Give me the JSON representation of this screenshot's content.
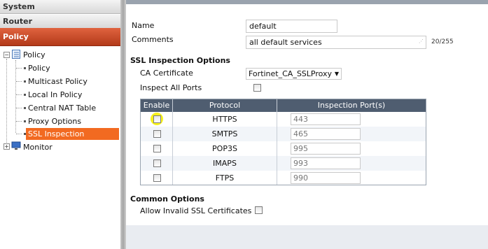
{
  "nav": {
    "system": "System",
    "router": "Router",
    "policy": "Policy",
    "tree": {
      "policy_folder": "Policy",
      "items": [
        "Policy",
        "Multicast Policy",
        "Local In Policy",
        "Central NAT Table",
        "Proxy Options",
        "SSL Inspection"
      ],
      "selected_index": 5,
      "monitor": "Monitor"
    }
  },
  "form": {
    "name_label": "Name",
    "name_value": "default",
    "comments_label": "Comments",
    "comments_value": "all default services",
    "comments_counter": "20/255",
    "ssl_heading": "SSL Inspection Options",
    "ca_label": "CA Certificate",
    "ca_value": "Fortinet_CA_SSLProxy",
    "inspect_all_label": "Inspect All Ports",
    "inspect_all_checked": false,
    "common_heading": "Common Options",
    "allow_invalid_label": "Allow Invalid SSL Certificates",
    "allow_invalid_checked": false
  },
  "table": {
    "headers": [
      "Enable",
      "Protocol",
      "Inspection Port(s)"
    ],
    "rows": [
      {
        "protocol": "HTTPS",
        "port": "443",
        "enabled": false,
        "highlighted": true
      },
      {
        "protocol": "SMTPS",
        "port": "465",
        "enabled": false
      },
      {
        "protocol": "POP3S",
        "port": "995",
        "enabled": false
      },
      {
        "protocol": "IMAPS",
        "port": "993",
        "enabled": false
      },
      {
        "protocol": "FTPS",
        "port": "990",
        "enabled": false
      }
    ]
  },
  "colors": {
    "policy_menu": "#c9452a",
    "selected_item": "#f26a21",
    "table_header": "#4f5d70",
    "highlight": "#f7f21c"
  }
}
